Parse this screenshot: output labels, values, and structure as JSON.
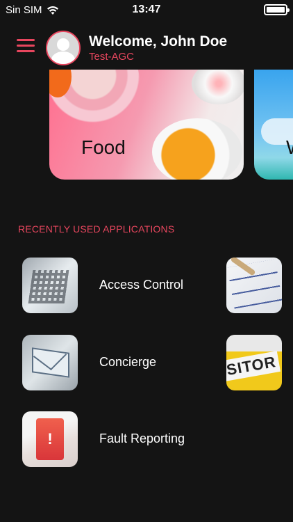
{
  "status_bar": {
    "carrier": "Sin SIM",
    "time": "13:47",
    "icons": [
      "wifi-icon",
      "battery-icon"
    ]
  },
  "header": {
    "welcome": "Welcome, John Doe",
    "organization": "Test-AGC",
    "menu_icon": "hamburger-menu-icon",
    "avatar_icon": "user-avatar-icon"
  },
  "categories": [
    {
      "label": "Food"
    },
    {
      "label": "W"
    }
  ],
  "recent": {
    "title": "RECENTLY USED APPLICATIONS",
    "apps": [
      {
        "label": "Access Control",
        "icon": "qr-code-icon"
      },
      {
        "label": "Concierge",
        "icon": "envelope-icon"
      },
      {
        "label": "Fault Reporting",
        "icon": "alert-phone-icon"
      },
      {
        "label": "",
        "icon": "checklist-icon"
      },
      {
        "label": "SITOR",
        "icon": "visitor-badge-icon"
      }
    ]
  },
  "colors": {
    "accent": "#e8465e",
    "background": "#141414"
  }
}
